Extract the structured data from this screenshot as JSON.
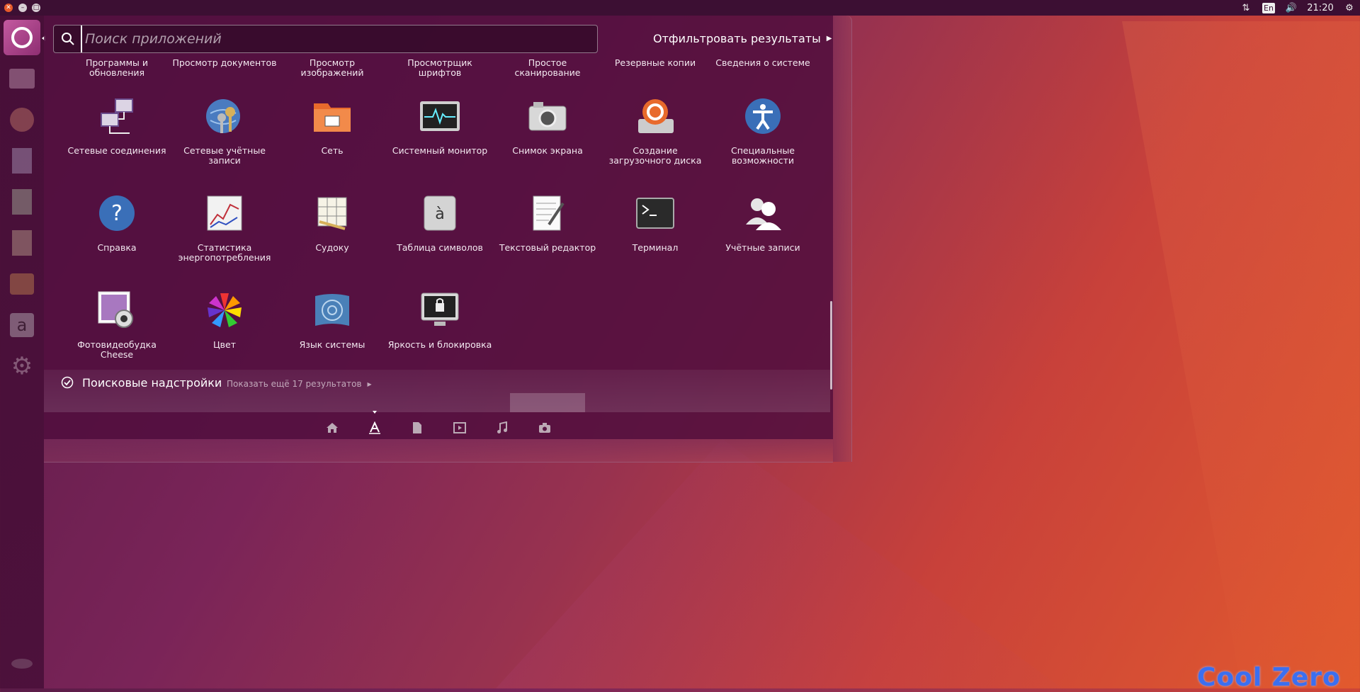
{
  "top_panel": {
    "keyboard_layout": "En",
    "time": "21:20",
    "icons": [
      "close-icon",
      "minimize-icon",
      "maximize-icon",
      "network-icon",
      "keyboard-layout-icon",
      "volume-icon",
      "settings-icon"
    ]
  },
  "search": {
    "placeholder": "Поиск приложений",
    "value": ""
  },
  "filter_label": "Отфильтровать результаты",
  "apps_row0": [
    {
      "label": "Программы и обновления"
    },
    {
      "label": "Просмотр документов"
    },
    {
      "label": "Просмотр изображений"
    },
    {
      "label": "Просмотрщик шрифтов"
    },
    {
      "label": "Простое сканирование"
    },
    {
      "label": "Резервные копии"
    },
    {
      "label": "Сведения о системе"
    }
  ],
  "apps": [
    {
      "label": "Сетевые соединения",
      "icon": "network-connections-icon"
    },
    {
      "label": "Сетевые учётные записи",
      "icon": "online-accounts-icon"
    },
    {
      "label": "Сеть",
      "icon": "network-folder-icon"
    },
    {
      "label": "Системный монитор",
      "icon": "system-monitor-icon"
    },
    {
      "label": "Снимок экрана",
      "icon": "camera-icon"
    },
    {
      "label": "Создание загрузочного диска",
      "icon": "startup-disk-icon"
    },
    {
      "label": "Специальные возможности",
      "icon": "accessibility-icon"
    },
    {
      "label": "Справка",
      "icon": "help-icon"
    },
    {
      "label": "Статистика энергопотребления",
      "icon": "power-statistics-icon"
    },
    {
      "label": "Судоку",
      "icon": "sudoku-icon"
    },
    {
      "label": "Таблица символов",
      "icon": "character-map-icon"
    },
    {
      "label": "Текстовый редактор",
      "icon": "text-editor-icon"
    },
    {
      "label": "Терминал",
      "icon": "terminal-icon"
    },
    {
      "label": "Учётные записи",
      "icon": "user-accounts-icon"
    },
    {
      "label": "Фотовидеобудка Cheese",
      "icon": "cheese-icon"
    },
    {
      "label": "Цвет",
      "icon": "color-icon"
    },
    {
      "label": "Язык системы",
      "icon": "language-icon"
    },
    {
      "label": "Яркость и блокировка",
      "icon": "brightness-lock-icon"
    }
  ],
  "plugins": {
    "title": "Поисковые надстройки",
    "show_more": "Показать ещё 17 результатов"
  },
  "lenses": [
    "home-icon",
    "applications-icon",
    "files-icon",
    "video-icon",
    "music-icon",
    "photos-icon"
  ],
  "watermark": "Cool Zero"
}
